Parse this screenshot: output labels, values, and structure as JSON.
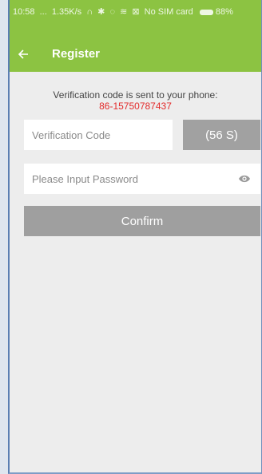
{
  "status_bar": {
    "time": "10:58",
    "dots": "...",
    "speed": "1.35K/s",
    "icons": [
      "headphones-icon",
      "bluetooth-icon",
      "alarm-icon",
      "wifi-icon",
      "sim-icon"
    ],
    "carrier": "No SIM card",
    "battery_percent": "88%"
  },
  "header": {
    "back_icon": "back-arrow-icon",
    "title": "Register"
  },
  "verification": {
    "notice": "Verification code is sent to your phone:",
    "phone": "86-15750787437",
    "code_placeholder": "Verification Code",
    "countdown": "(56 S)"
  },
  "password": {
    "placeholder": "Please Input Password",
    "toggle_icon": "eye-icon"
  },
  "confirm_label": "Confirm",
  "colors": {
    "header_green": "#8cc342",
    "phone_red": "#e32b2b",
    "button_gray": "#9f9f9f"
  }
}
